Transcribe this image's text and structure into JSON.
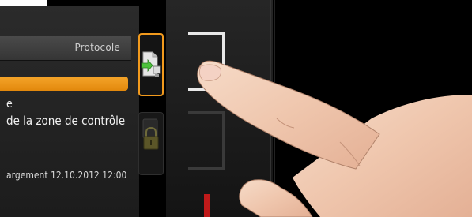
{
  "panel": {
    "header_title": "Protocole",
    "progress_fraction": 1.0,
    "line1": "e",
    "line2": "de la zone de contrôle",
    "line3": "argement  12.10.2012  12:00"
  },
  "buttons": {
    "export": {
      "icon": "document-export-icon"
    },
    "lock": {
      "icon": "lock-icon"
    }
  },
  "colors": {
    "accent": "#f29a1d",
    "panel_bg": "#262626",
    "text": "#f2f2f2",
    "red_mark": "#c01a1a"
  }
}
